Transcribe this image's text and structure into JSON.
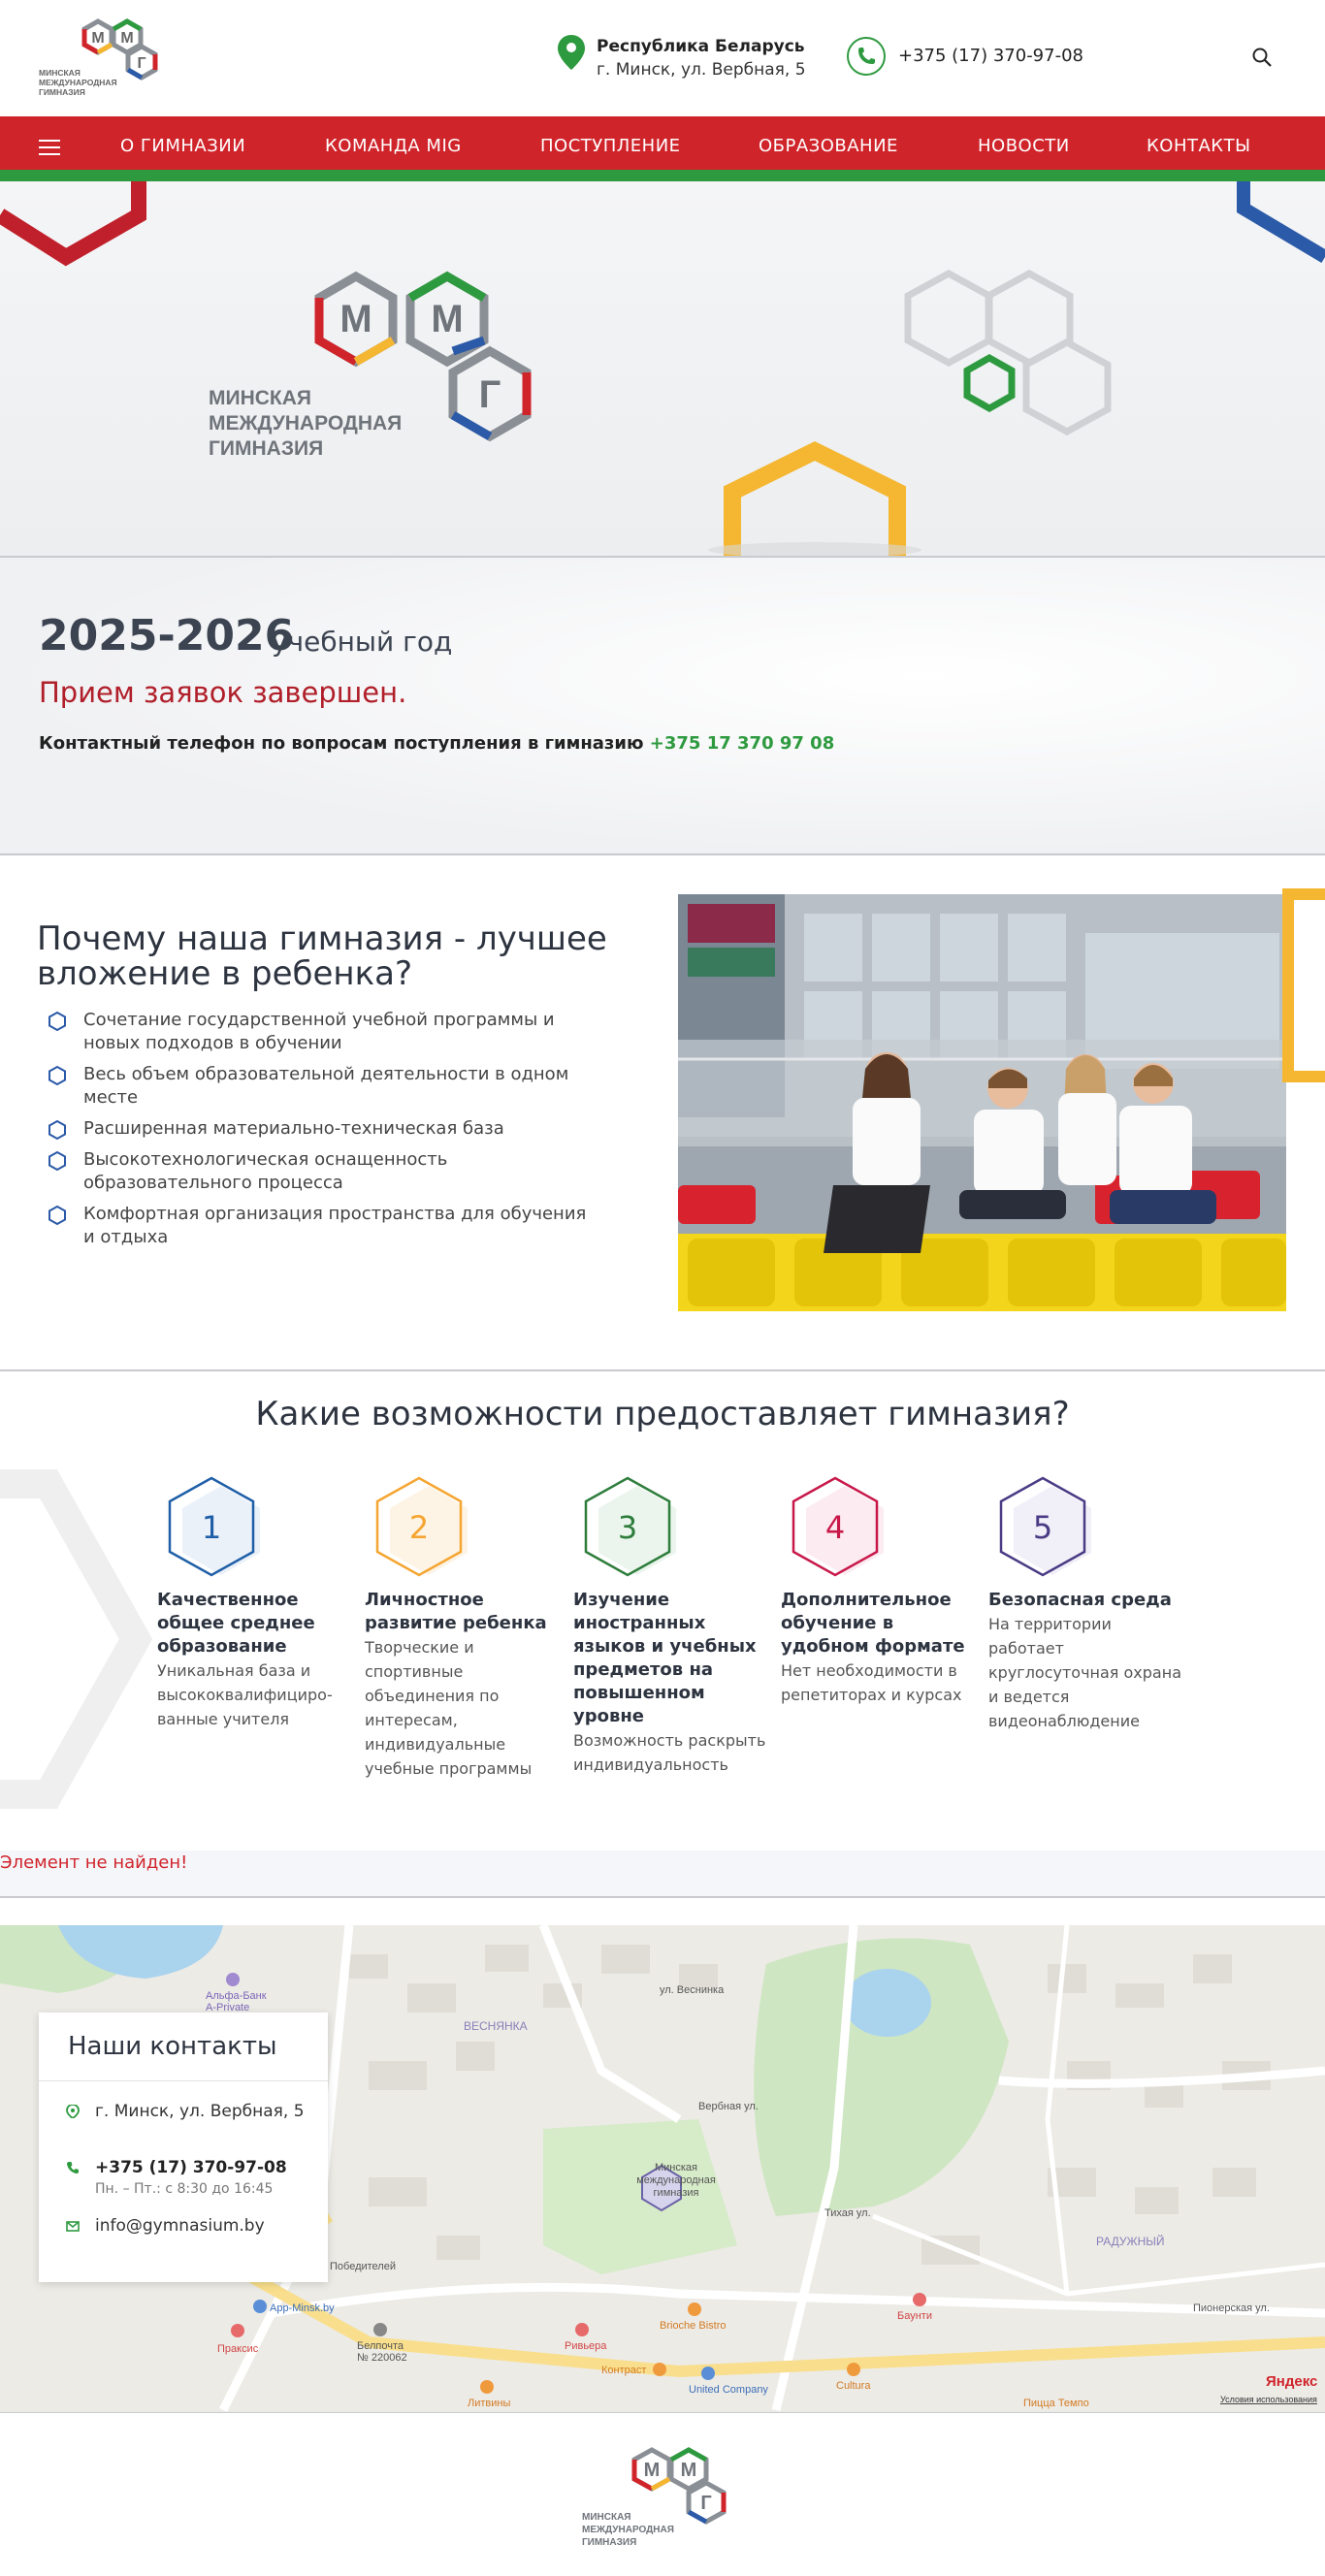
{
  "header": {
    "logo": {
      "letters": [
        "М",
        "М",
        "Г"
      ],
      "name_lines": [
        "МИНСКАЯ",
        "МЕЖДУНАРОДНАЯ",
        "ГИМНАЗИЯ"
      ]
    },
    "location": {
      "country": "Республика Беларусь",
      "address": "г. Минск, ул. Вербная, 5"
    },
    "phone": "+375 (17) 370-97-08",
    "icons": {
      "location": "map-pin-icon",
      "phone": "phone-icon",
      "search": "search-icon",
      "menu": "hamburger-icon"
    }
  },
  "nav": {
    "items": [
      "О ГИМНАЗИИ",
      "КОМАНДА MIG",
      "ПОСТУПЛЕНИЕ",
      "ОБРАЗОВАНИЕ",
      "НОВОСТИ",
      "КОНТАКТЫ"
    ]
  },
  "hero": {
    "logo": {
      "letters": [
        "М",
        "М",
        "Г"
      ],
      "name_lines": [
        "МИНСКАЯ",
        "МЕЖДУНАРОДНАЯ",
        "ГИМНАЗИЯ"
      ]
    }
  },
  "admission": {
    "year": "2025-2026",
    "year_suffix": "учебный год",
    "status": "Прием заявок завершен.",
    "contact_text": "Контактный телефон по вопросам поступления в гимназию",
    "contact_phone": "+375 17 370 97 08"
  },
  "why": {
    "title": "Почему наша гимназия - лучшее вложение в ребенка?",
    "items": [
      "Сочетание государственной учебной программы и новых подходов в обучении",
      "Весь объем образовательной деятельности в одном месте",
      "Расширенная материально-техническая база",
      "Высокотехнологическая оснащенность образовательного процесса",
      "Комфортная организация пространства для обучения и отдыха"
    ]
  },
  "opportunities": {
    "title": "Какие возможности предоставляет гимназия?",
    "items": [
      {
        "num": "1",
        "title": "Качественное общее среднее образование",
        "desc": "Уникальная база и высококвалифициро-ванные учителя",
        "color": "#1f5fa8"
      },
      {
        "num": "2",
        "title": "Личностное развитие ребенка",
        "desc": "Творческие и спортивные объединения по интересам, индивидуальные учебные программы",
        "color": "#f5a531"
      },
      {
        "num": "3",
        "title": "Изучение иностранных языков и учебных предметов на повышенном уровне",
        "desc": "Возможность раскрыть индивидуальность",
        "color": "#2e7d3c"
      },
      {
        "num": "4",
        "title": "Дополнительное обучение в удобном формате",
        "desc": "Нет необходимости в репетиторах и курсах",
        "color": "#c8184a"
      },
      {
        "num": "5",
        "title": "Безопасная среда",
        "desc": "На территории работает круглосуточная охрана и ведется видеонаблюдение",
        "color": "#4a3b85"
      }
    ]
  },
  "error_message": "Элемент не найден!",
  "contacts": {
    "title": "Наши контакты",
    "address": "г. Минск, ул. Вербная, 5",
    "phone": "+375 (17) 370-97-08",
    "hours": "Пн. – Пт.: с 8:30 до 16:45",
    "email": "info@gymnasium.by"
  },
  "map": {
    "labels": {
      "gymnasium": [
        "Минская",
        "международная",
        "гимназия"
      ],
      "district_1": "ВЕСНЯНКА",
      "district_2": "РАДУЖНЫЙ",
      "street_1": "ул. Веснинка",
      "street_2": "Вербная ул.",
      "street_3": "Тихая ул.",
      "street_4": "Пионерская ул.",
      "street_5": "Победителей",
      "poi_1": "Альфа-Банк",
      "poi_1b": "A-Private",
      "poi_2": "App-Minsk.by",
      "poi_3": "Праксис",
      "poi_4": "Белпочта",
      "poi_4b": "№ 220062",
      "poi_5": "Ривьера",
      "poi_6": "Brioche Bistro",
      "poi_7": "Баунти",
      "poi_8": "Контраст",
      "poi_9": "United Company",
      "poi_10": "Cultura",
      "poi_11": "Литвины",
      "poi_12": "Пицца Темпо",
      "brand": "Яндекс",
      "terms": "Условия использования"
    }
  },
  "footer": {
    "logo": {
      "letters": [
        "М",
        "М",
        "Г"
      ],
      "name_lines": [
        "МИНСКАЯ",
        "МЕЖДУНАРОДНАЯ",
        "ГИМНАЗИЯ"
      ]
    }
  },
  "colors": {
    "red": "#d0242b",
    "green": "#2e9a3f",
    "blue": "#2b5aa8",
    "yellow": "#f5b731",
    "grey": "#8a8f96"
  }
}
